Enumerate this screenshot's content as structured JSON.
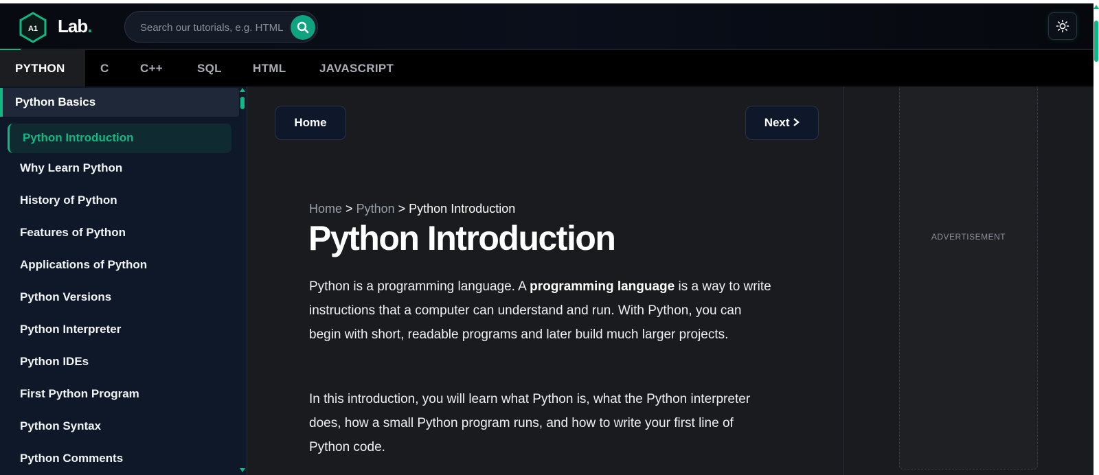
{
  "header": {
    "logo_badge": "A1",
    "logo_text": "Lab",
    "logo_dot": ".",
    "search_placeholder": "Search our tutorials, e.g. HTML"
  },
  "languages": [
    {
      "label": "PYTHON",
      "active": true
    },
    {
      "label": "C"
    },
    {
      "label": "C++"
    },
    {
      "label": "SQL"
    },
    {
      "label": "HTML"
    },
    {
      "label": "JAVASCRIPT"
    }
  ],
  "sidebar": {
    "section": "Python Basics",
    "items": [
      "Python Introduction",
      "Why Learn Python",
      "History of Python",
      "Features of Python",
      "Applications of Python",
      "Python Versions",
      "Python Interpreter",
      "Python IDEs",
      "First Python Program",
      "Python Syntax",
      "Python Comments"
    ]
  },
  "main": {
    "home_button": "Home",
    "next_button": "Next",
    "breadcrumb": {
      "home": "Home",
      "sep": ">",
      "python": "Python",
      "current": "Python Introduction"
    },
    "title": "Python Introduction",
    "para1": {
      "pre": "Python is a programming language. A ",
      "bold": "programming language",
      "post": " is a way to write instructions that a computer can understand and run. With Python, you can begin with short, readable programs and later build much larger projects."
    },
    "para2": "In this introduction, you will learn what Python is, what the Python interpreter does, how a small Python program runs, and how to write your first line of Python code."
  },
  "ad": {
    "label": "ADVERTISEMENT"
  },
  "colors": {
    "accent": "#10b981",
    "header_bg": "#0a0f1b",
    "sidebar_bg": "#0f1829",
    "main_bg": "#1a1b1e"
  }
}
